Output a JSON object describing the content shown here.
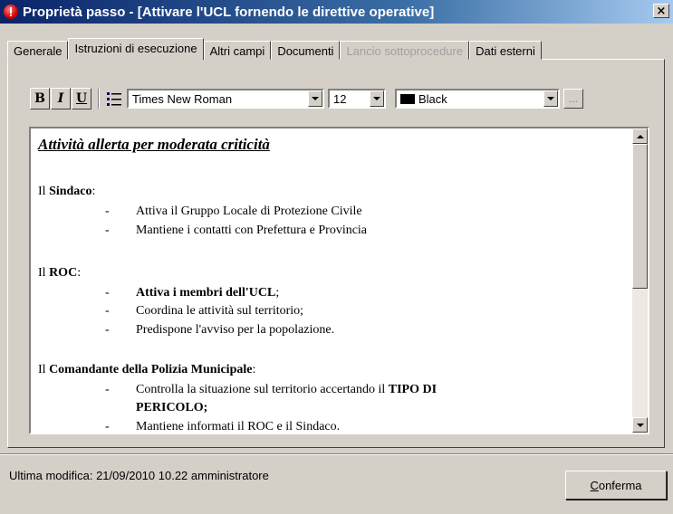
{
  "window": {
    "title": "Proprietà passo - [Attivare l'UCL fornendo le direttive operative]",
    "close_label": "×"
  },
  "tabs": [
    {
      "label": "Generale",
      "state": "normal"
    },
    {
      "label": "Istruzioni di esecuzione",
      "state": "active"
    },
    {
      "label": "Altri campi",
      "state": "normal"
    },
    {
      "label": "Documenti",
      "state": "normal"
    },
    {
      "label": "Lancio sottoprocedure",
      "state": "disabled"
    },
    {
      "label": "Dati esterni",
      "state": "normal"
    }
  ],
  "toolbar": {
    "bold_label": "B",
    "italic_label": "I",
    "underline_label": "U",
    "list_icon": "bulleted-list-icon",
    "font_family": "Times New Roman",
    "font_size": "12",
    "color_name": "Black",
    "color_hex": "#000000",
    "more_label": "..."
  },
  "document": {
    "title": "Attività allerta per moderata criticità",
    "sections": [
      {
        "prefix": "Il ",
        "role": "Sindaco",
        "suffix": ":",
        "items": [
          {
            "text": "Attiva il Gruppo Locale di Protezione Civile",
            "bold": false
          },
          {
            "text": "Mantiene i contatti con Prefettura e Provincia",
            "bold": false
          }
        ]
      },
      {
        "prefix": "Il ",
        "role": "ROC",
        "suffix": ":",
        "items": [
          {
            "text": "Attiva i membri dell'UCL",
            "bold": true,
            "tail": ";"
          },
          {
            "text": "Coordina le attività sul territorio;",
            "bold": false
          },
          {
            "text": "Predispone l'avviso per la popolazione.",
            "bold": false
          }
        ]
      },
      {
        "prefix": "Il ",
        "role": "Comandante della Polizia Municipale",
        "suffix": ":",
        "items": [
          {
            "text": "Controlla la situazione sul territorio accertando il ",
            "bold_tail": "TIPO DI",
            "bold": false
          },
          {
            "text": "PERICOLO;",
            "bold": true,
            "continuation": true
          },
          {
            "text": "Mantiene informati il ROC e il Sindaco.",
            "bold": false
          }
        ]
      }
    ],
    "dash": "-"
  },
  "status": {
    "last_modified": "Ultima modifica: 21/09/2010 10.22 amministratore"
  },
  "buttons": {
    "confirm_first": "C",
    "confirm_rest": "onferma"
  }
}
